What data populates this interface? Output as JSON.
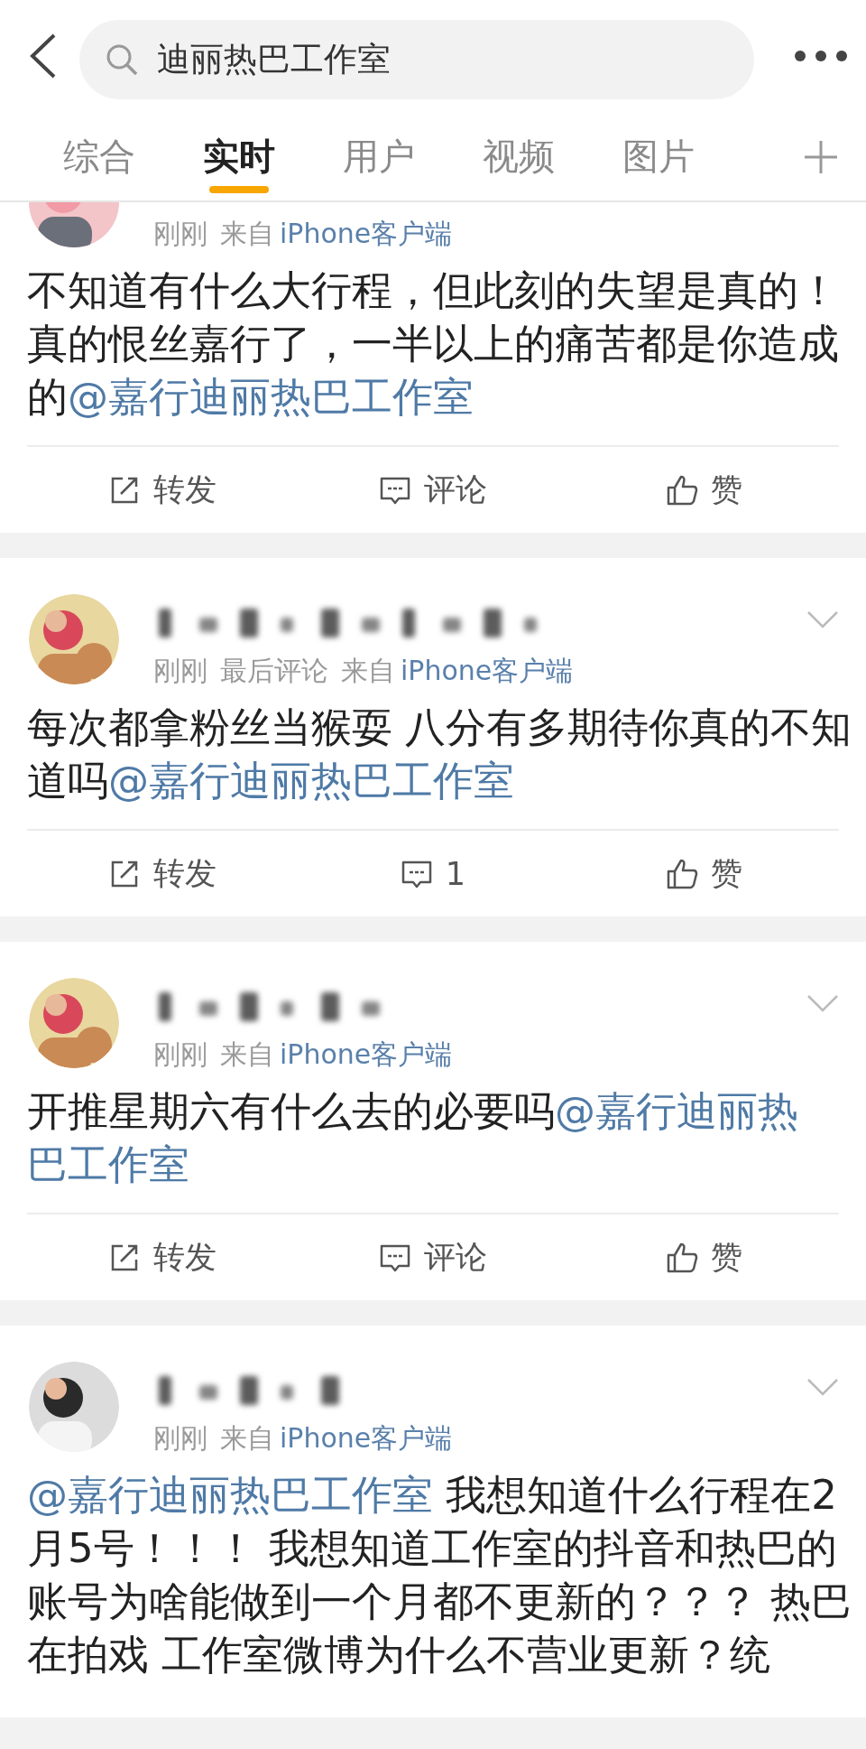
{
  "search": {
    "value": "迪丽热巴工作室"
  },
  "tabs": [
    {
      "label": "综合",
      "selected": false
    },
    {
      "label": "实时",
      "selected": true
    },
    {
      "label": "用户",
      "selected": false
    },
    {
      "label": "视频",
      "selected": false
    },
    {
      "label": "图片",
      "selected": false
    }
  ],
  "posts": [
    {
      "top_cut": true,
      "time": "刚刚",
      "source_label": "来自",
      "source": "iPhone客户端",
      "segments": [
        {
          "kind": "text",
          "text": "不知道有什么大行程，但此刻的失望是真的！真的恨丝嘉行了，一半以上的痛苦都是你造成的"
        },
        {
          "kind": "mention",
          "text": "@嘉行迪丽热巴工作室"
        }
      ],
      "actions": [
        {
          "kind": "repost",
          "label": "转发"
        },
        {
          "kind": "comment",
          "label": "评论"
        },
        {
          "kind": "like",
          "label": "赞"
        }
      ]
    },
    {
      "top_cut": false,
      "time": "刚刚",
      "note": "最后评论",
      "source_label": "来自",
      "source": "iPhone客户端",
      "segments": [
        {
          "kind": "text",
          "text": "每次都拿粉丝当猴耍 八分有多期待你真的不知道吗"
        },
        {
          "kind": "mention",
          "text": "@嘉行迪丽热巴工作室"
        }
      ],
      "actions": [
        {
          "kind": "repost",
          "label": "转发"
        },
        {
          "kind": "comment",
          "label": "1"
        },
        {
          "kind": "like",
          "label": "赞"
        }
      ]
    },
    {
      "top_cut": false,
      "time": "刚刚",
      "source_label": "来自",
      "source": "iPhone客户端",
      "segments": [
        {
          "kind": "text",
          "text": "开推星期六有什么去的必要吗"
        },
        {
          "kind": "mention",
          "text": "@嘉行迪丽热"
        },
        {
          "kind": "mention",
          "text": "巴工作室"
        }
      ],
      "actions": [
        {
          "kind": "repost",
          "label": "转发"
        },
        {
          "kind": "comment",
          "label": "评论"
        },
        {
          "kind": "like",
          "label": "赞"
        }
      ]
    },
    {
      "top_cut": false,
      "time": "刚刚",
      "source_label": "来自",
      "source": "iPhone客户端",
      "segments": [
        {
          "kind": "mention",
          "text": "@嘉行迪丽热巴工作室"
        },
        {
          "kind": "text",
          "text": " 我想知道什么行程在2月5号！！！ 我想知道工作室的抖音和热巴的账号为啥能做到一个月都不更新的？？？ 热巴在拍戏 工作室微博为什么不营业更新？统"
        }
      ]
    }
  ]
}
